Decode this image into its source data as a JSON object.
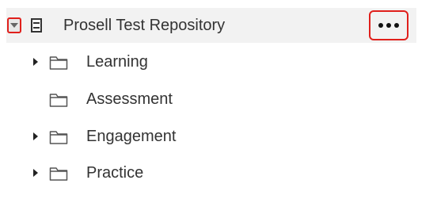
{
  "root": {
    "label": "Prosell Test Repository",
    "toggle_icon": "caret-down-icon",
    "type_icon": "repository-icon",
    "more_icon": "ellipsis-icon"
  },
  "children": [
    {
      "label": "Learning",
      "expandable": true,
      "icon": "folder-icon"
    },
    {
      "label": "Assessment",
      "expandable": false,
      "icon": "folder-icon"
    },
    {
      "label": "Engagement",
      "expandable": true,
      "icon": "folder-icon"
    },
    {
      "label": "Practice",
      "expandable": true,
      "icon": "folder-icon"
    }
  ],
  "colors": {
    "highlight_border": "#e0201c",
    "row_background": "#f2f2f2",
    "text": "#333333"
  }
}
